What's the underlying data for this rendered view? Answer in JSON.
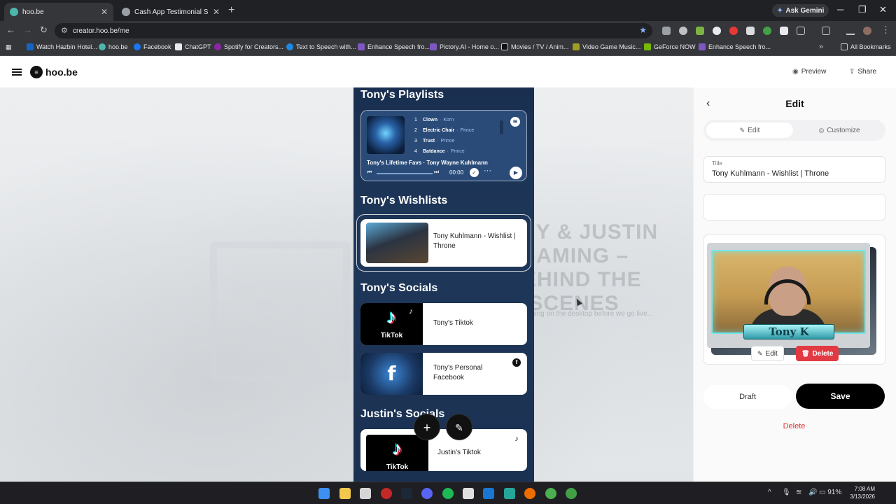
{
  "browser": {
    "tabs": [
      {
        "label": "hoo.be",
        "active": true
      },
      {
        "label": "Cash App Testimonial Suggesti",
        "active": false
      }
    ],
    "gemini_label": "Ask Gemini",
    "url": "creator.hoo.be/me",
    "bookmarks": [
      "Watch Hazbin Hotel...",
      "hoo.be",
      "Facebook",
      "ChatGPT",
      "Spotify for Creators...",
      "Text to Speech with...",
      "Enhance Speech fro...",
      "Pictory.AI - Home o...",
      "Movies / TV / Anim...",
      "Video Game Music...",
      "GeForce NOW",
      "Enhance Speech fro..."
    ],
    "all_bookmarks": "All Bookmarks"
  },
  "app": {
    "logo": "hoo.be",
    "preview_label": "Preview",
    "share_label": "Share"
  },
  "background": {
    "title": "TONY & JUSTIN GAMING – BEHIND THE SCENES",
    "subtitle": "What's happening on the desktop before we go live..."
  },
  "phone": {
    "playlists_title": "Tony's Playlists",
    "playlist": {
      "tracks": [
        {
          "num": "1",
          "title": "Clown",
          "artist": "Korn"
        },
        {
          "num": "2",
          "title": "Electric Chair",
          "artist": "Prince"
        },
        {
          "num": "3",
          "title": "Trust",
          "artist": "Prince"
        },
        {
          "num": "4",
          "title": "Batdance",
          "artist": "Prince"
        }
      ],
      "caption": "Tony's Lifetime Favs · Tony Wayne Kuhlmann",
      "time": "00:00"
    },
    "wishlists_title": "Tony's Wishlists",
    "wishlist_label": "Tony Kuhlmann - Wishlist | Throne",
    "socials_title": "Tony's Socials",
    "tiktok_label": "Tony's Tiktok",
    "facebook_label": "Tony's Personal Facebook",
    "justin_title": "Justin's Socials",
    "justin_tiktok_label": "Justin's Tiktok",
    "tiktok_logo_text": "TikTok"
  },
  "editor": {
    "title": "Edit",
    "tab_edit": "Edit",
    "tab_customize": "Customize",
    "field_label": "Title",
    "field_value": "Tony Kuhlmann - Wishlist | Throne",
    "webcam_name": "Tony K",
    "image_edit": "Edit",
    "image_delete": "Delete",
    "draft": "Draft",
    "save": "Save",
    "delete": "Delete"
  },
  "taskbar": {
    "battery": "91%",
    "time": "7:08 AM",
    "date": "3/13/2026"
  },
  "colors": {
    "accent_black": "#000000",
    "delete_red": "#e23a43",
    "phone_bg": "#1e3759",
    "chrome_dark": "#202124"
  }
}
